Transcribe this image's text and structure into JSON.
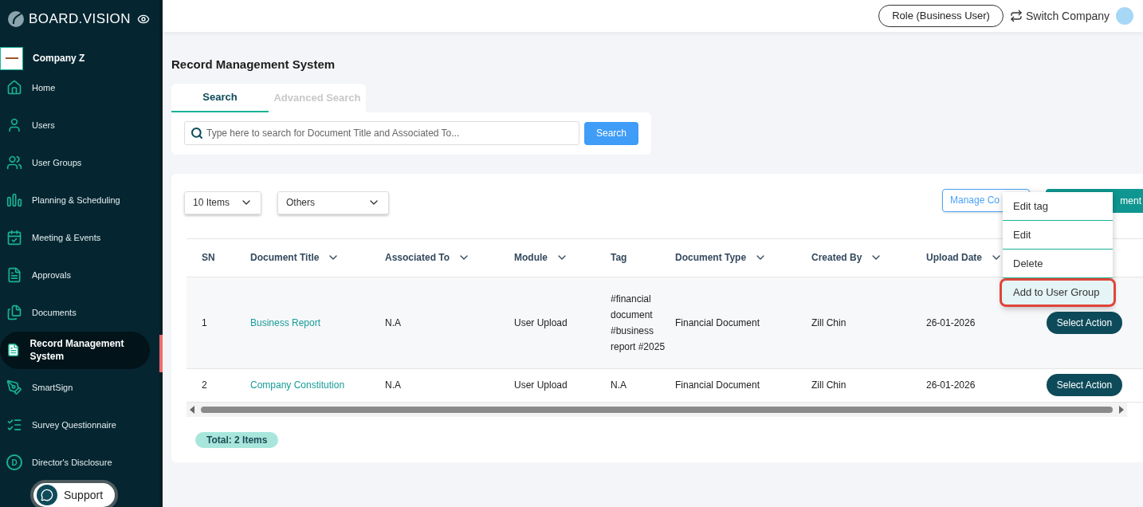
{
  "sidebar": {
    "logo": "BOARD.VISION",
    "company": "Company Z",
    "items": [
      {
        "label": "Home",
        "selected": false
      },
      {
        "label": "Users",
        "selected": false
      },
      {
        "label": "User Groups",
        "selected": false
      },
      {
        "label": "Planning & Scheduling",
        "selected": false
      },
      {
        "label": "Meeting & Events",
        "selected": false
      },
      {
        "label": "Approvals",
        "selected": false
      },
      {
        "label": "Documents",
        "selected": false
      },
      {
        "label": "Record Management System",
        "selected": true
      },
      {
        "label": "SmartSign",
        "selected": false
      },
      {
        "label": "Survey Questionnaire",
        "selected": false
      },
      {
        "label": "Director's Disclosure",
        "icon_letter": "D",
        "selected": false
      }
    ],
    "support": "Support"
  },
  "header": {
    "role": "Role (Business User)",
    "switch": "Switch Company"
  },
  "page_title": "Record Management System",
  "tabs": [
    {
      "label": "Search",
      "selected": true
    },
    {
      "label": "Advanced Search",
      "selected": false
    }
  ],
  "search": {
    "placeholder": "Type here to search for Document Title and Associated To...",
    "button": "Search"
  },
  "filters": [
    "10 Items",
    "Others"
  ],
  "buttons": {
    "manage": "Manage Co",
    "upload": "ment"
  },
  "table": {
    "columns": [
      {
        "label": "SN",
        "sortable": false
      },
      {
        "label": "Document Title",
        "sortable": true
      },
      {
        "label": "Associated To",
        "sortable": true
      },
      {
        "label": "Module",
        "sortable": true
      },
      {
        "label": "Tag",
        "sortable": false
      },
      {
        "label": "Document Type",
        "sortable": true
      },
      {
        "label": "Created By",
        "sortable": true
      },
      {
        "label": "Upload Date",
        "sortable": true
      }
    ],
    "rows": [
      {
        "cells": [
          "1",
          "Business Report",
          "N.A",
          "User Upload",
          "#financial document #business report #2025",
          "Financial Document",
          "Zill Chin",
          "26-01-2026"
        ],
        "action": "Select Action"
      },
      {
        "cells": [
          "2",
          "Company Constitution",
          "N.A",
          "User Upload",
          "N.A",
          "Financial Document",
          "Zill Chin",
          "26-01-2026"
        ],
        "action": "Select Action"
      }
    ]
  },
  "menu": [
    {
      "label": "Edit tag",
      "highlighted": false
    },
    {
      "label": "Edit",
      "highlighted": false
    },
    {
      "label": "Delete",
      "highlighted": false
    },
    {
      "label": "Add to User Group",
      "highlighted": true
    }
  ],
  "total": "Total: 2 Items"
}
